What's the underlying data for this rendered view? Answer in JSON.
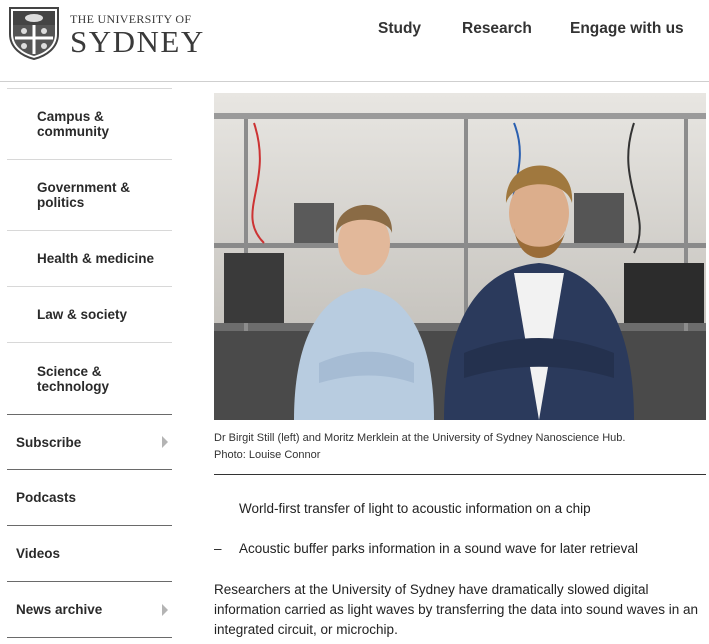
{
  "header": {
    "logo": {
      "line1": "THE UNIVERSITY OF",
      "line2": "SYDNEY"
    },
    "nav": [
      {
        "label": "Study"
      },
      {
        "label": "Research"
      },
      {
        "label": "Engage with us"
      }
    ]
  },
  "sidebar": {
    "sub_items": [
      {
        "label": "Campus & community"
      },
      {
        "label": "Government & politics"
      },
      {
        "label": "Health & medicine"
      },
      {
        "label": "Law & society"
      },
      {
        "label": "Science & technology"
      }
    ],
    "main_items": [
      {
        "label": "Subscribe",
        "has_arrow": true
      },
      {
        "label": "Podcasts",
        "has_arrow": false
      },
      {
        "label": "Videos",
        "has_arrow": false
      },
      {
        "label": "News archive",
        "has_arrow": true
      }
    ]
  },
  "article": {
    "caption_line1": "Dr Birgit Still (left) and Moritz Merklein at the University of Sydney Nanoscience Hub.",
    "caption_line2": "Photo: Louise Connor",
    "bullets": [
      {
        "marker": "",
        "text": "World-first transfer of light to acoustic information on a chip"
      },
      {
        "marker": "–",
        "text": "Acoustic buffer parks information in a sound wave for later retrieval"
      }
    ],
    "body": "Researchers at the University of Sydney have dramatically slowed digital information carried as light waves by transferring the data into sound waves in an integrated circuit, or microchip."
  },
  "colors": {
    "text": "#1a1a1a",
    "rule": "#6a6a6a",
    "arrow": "#b4b4b4"
  }
}
